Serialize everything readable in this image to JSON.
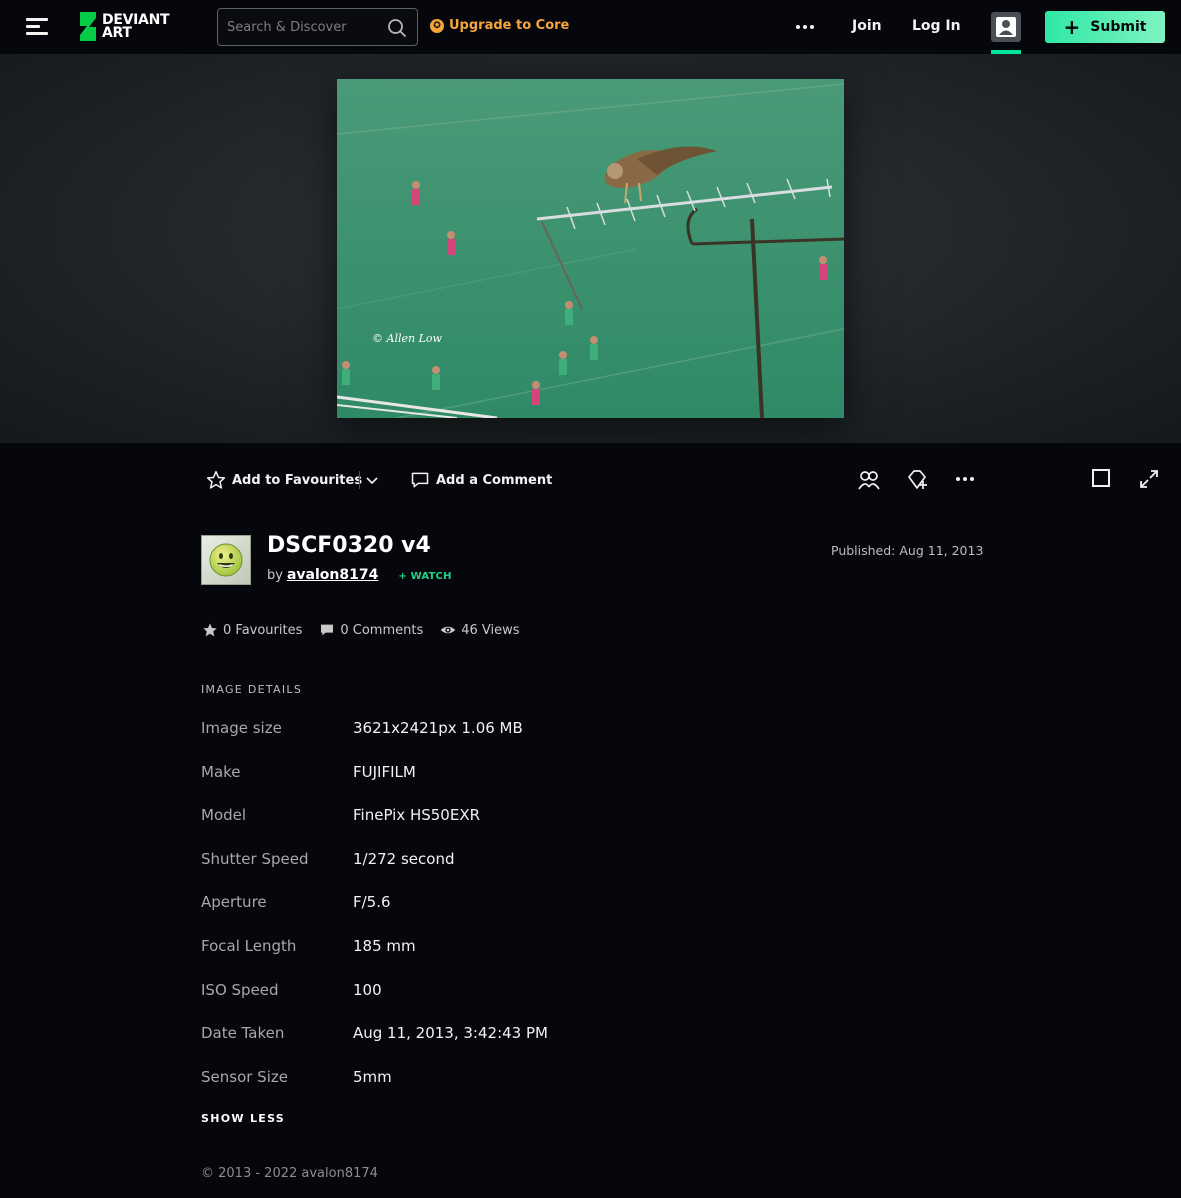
{
  "header": {
    "logo_text": "DEVIANT\nART",
    "search_placeholder": "Search & Discover",
    "upgrade_label": "Upgrade to Core",
    "join_label": "Join",
    "login_label": "Log In",
    "submit_label": "Submit",
    "accent_color": "#00e59b",
    "upgrade_color": "#f6a53b"
  },
  "artwork": {
    "watermark": "© Allen Low"
  },
  "actions": {
    "add_favourites_label": "Add to Favourites",
    "add_comment_label": "Add a Comment"
  },
  "deviation": {
    "title": "DSCF0320 v4",
    "by_label": "by",
    "author": "avalon8174",
    "watch_label": "+ WATCH",
    "published": "Published: Aug 11, 2013"
  },
  "stats": {
    "favourites": "0 Favourites",
    "comments": "0 Comments",
    "views": "46 Views"
  },
  "image_details": {
    "heading": "IMAGE DETAILS",
    "rows": [
      {
        "label": "Image size",
        "value": "3621x2421px 1.06 MB"
      },
      {
        "label": "Make",
        "value": "FUJIFILM"
      },
      {
        "label": "Model",
        "value": "FinePix HS50EXR"
      },
      {
        "label": "Shutter Speed",
        "value": "1/272 second"
      },
      {
        "label": "Aperture",
        "value": "F/5.6"
      },
      {
        "label": "Focal Length",
        "value": "185 mm"
      },
      {
        "label": "ISO Speed",
        "value": "100"
      },
      {
        "label": "Date Taken",
        "value": "Aug 11, 2013, 3:42:43 PM"
      },
      {
        "label": "Sensor Size",
        "value": "5mm"
      }
    ],
    "show_less_label": "SHOW LESS"
  },
  "footer": {
    "copyright": "© 2013 - 2022 avalon8174"
  }
}
